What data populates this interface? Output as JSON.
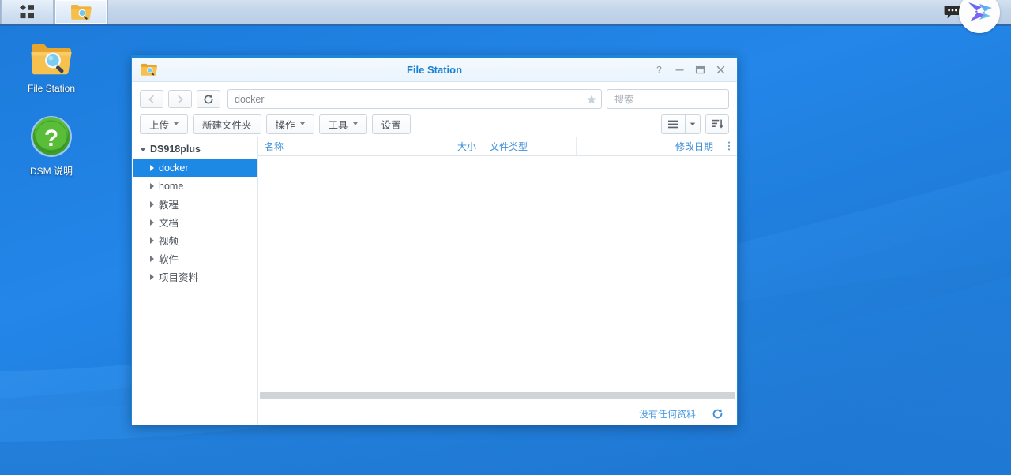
{
  "taskbar": {
    "main_menu_icon": "apps-grid-icon",
    "app_buttons": [
      {
        "name": "file-station",
        "icon": "folder-search-icon",
        "active": true
      }
    ],
    "right_icons": [
      {
        "name": "notifications-icon",
        "glyph": "chat-bubble-icon"
      },
      {
        "name": "search-icon",
        "glyph": "magnifier-icon"
      }
    ],
    "logo": "synology-logo-icon",
    "background": "#c2d4e9",
    "border_color": "#2c68b0"
  },
  "desktop": {
    "wallpaper_colors": [
      "#1f7fe0",
      "#2283e4",
      "#1f79d6",
      "#2a8cec"
    ],
    "icons": [
      {
        "name": "file-station",
        "label": "File Station",
        "icon": "folder-search-icon"
      },
      {
        "name": "dsm-help",
        "label": "DSM 说明",
        "icon": "question-circle-icon"
      }
    ]
  },
  "window": {
    "title": "File Station",
    "icon": "folder-search-icon",
    "accent": "#1d86d8",
    "controls": [
      {
        "name": "help-button",
        "glyph": "?"
      },
      {
        "name": "minimize-button",
        "glyph": "—"
      },
      {
        "name": "maximize-button",
        "glyph": "▭"
      },
      {
        "name": "close-button",
        "glyph": "✕"
      }
    ],
    "nav": {
      "back_label": "‹",
      "forward_label": "›",
      "refresh_label": "↻",
      "path_value": "docker",
      "path_placeholder": "",
      "favorite_icon": "star-icon"
    },
    "search": {
      "placeholder": "搜索",
      "value": "",
      "icon": "magnifier-dropdown-icon"
    },
    "toolbar": {
      "buttons": [
        {
          "name": "upload-button",
          "label": "上传",
          "has_caret": true
        },
        {
          "name": "new-folder-button",
          "label": "新建文件夹",
          "has_caret": false
        },
        {
          "name": "action-button",
          "label": "操作",
          "has_caret": true
        },
        {
          "name": "tools-button",
          "label": "工具",
          "has_caret": true
        },
        {
          "name": "settings-button",
          "label": "设置",
          "has_caret": false
        }
      ],
      "view_button": "list-view-icon",
      "view_dropdown": "chevron-down-icon",
      "sort_button": "sort-descending-icon"
    },
    "sidebar": {
      "root": {
        "label": "DS918plus",
        "expanded": true
      },
      "items": [
        {
          "label": "docker",
          "selected": true
        },
        {
          "label": "home",
          "selected": false
        },
        {
          "label": "教程",
          "selected": false
        },
        {
          "label": "文档",
          "selected": false
        },
        {
          "label": "视频",
          "selected": false
        },
        {
          "label": "软件",
          "selected": false
        },
        {
          "label": "项目资料",
          "selected": false
        }
      ]
    },
    "filelist": {
      "columns": [
        {
          "name": "name",
          "label": "名称",
          "align": "left"
        },
        {
          "name": "size",
          "label": "大小",
          "align": "right"
        },
        {
          "name": "filetype",
          "label": "文件类型",
          "align": "left"
        },
        {
          "name": "modified",
          "label": "修改日期",
          "align": "right"
        }
      ],
      "column_options_icon": "vertical-dots-icon",
      "rows": []
    },
    "statusbar": {
      "text": "没有任何资料",
      "refresh_icon": "refresh-icon"
    }
  }
}
